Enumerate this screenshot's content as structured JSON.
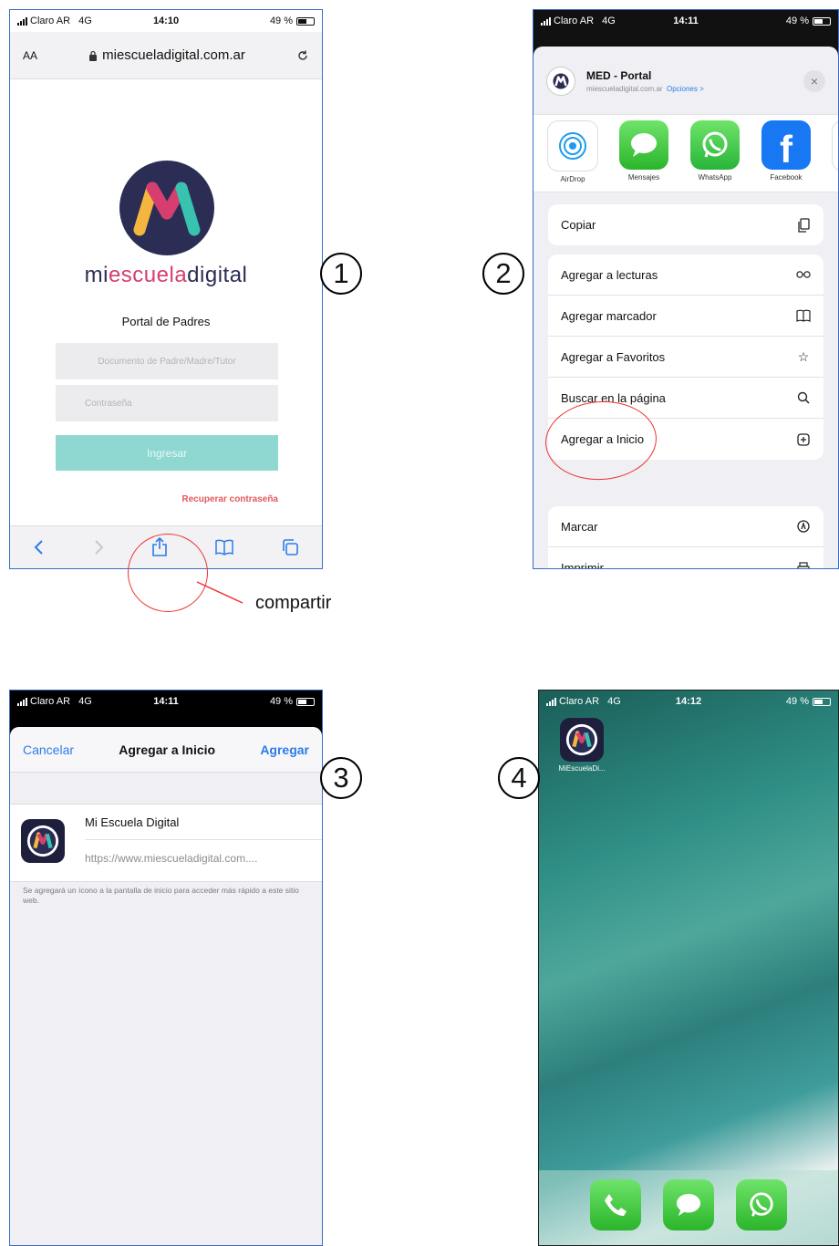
{
  "phone1": {
    "status": {
      "carrier": "Claro AR",
      "network": "4G",
      "time": "14:10",
      "battery": "49 %"
    },
    "url": {
      "text_size": "AA",
      "domain": "miescueladigital.com.ar"
    },
    "brand": {
      "part1": "mi",
      "part2": "escuela",
      "part3": "digital"
    },
    "portal_title": "Portal de Padres",
    "doc_placeholder": "Documento de Padre/Madre/Tutor",
    "pass_placeholder": "Contraseña",
    "login_label": "Ingresar",
    "recover_label": "Recuperar contraseña"
  },
  "annotation": {
    "share_label": "compartir",
    "step1": "1",
    "step2": "2",
    "step3": "3",
    "step4": "4"
  },
  "phone2": {
    "status": {
      "carrier": "Claro AR",
      "network": "4G",
      "time": "14:11",
      "battery": "49 %"
    },
    "title": "MED - Portal",
    "domain": "miescueladigital.com.ar",
    "options": "Opciones >",
    "apps": [
      {
        "label": "AirDrop"
      },
      {
        "label": "Mensajes"
      },
      {
        "label": "WhatsApp"
      },
      {
        "label": "Facebook"
      }
    ],
    "actions": [
      {
        "label": "Copiar",
        "icon": "copy-icon"
      },
      {
        "label": "Agregar a lecturas",
        "icon": "glasses-icon"
      },
      {
        "label": "Agregar marcador",
        "icon": "book-icon"
      },
      {
        "label": "Agregar a Favoritos",
        "icon": "star-icon"
      },
      {
        "label": "Buscar en la página",
        "icon": "search-icon"
      },
      {
        "label": "Agregar a Inicio",
        "icon": "plus-square-icon"
      },
      {
        "label": "Marcar",
        "icon": "markup-icon"
      },
      {
        "label": "Imprimir",
        "icon": "printer-icon"
      }
    ]
  },
  "phone3": {
    "status": {
      "carrier": "Claro AR",
      "network": "4G",
      "time": "14:11",
      "battery": "49 %"
    },
    "cancel": "Cancelar",
    "title": "Agregar a Inicio",
    "add": "Agregar",
    "site_name": "Mi Escuela Digital",
    "site_url": "https://www.miescueladigital.com....",
    "hint": "Se agregará un ícono a la pantalla de inicio para acceder más rápido a este sitio web."
  },
  "phone4": {
    "status": {
      "carrier": "Claro AR",
      "network": "4G",
      "time": "14:12",
      "battery": "49 %"
    },
    "app_label": "MiEscuelaDi..."
  },
  "colors": {
    "brand_navy": "#2b2d55",
    "brand_pink": "#d63e6f",
    "teal_button": "#8fd8d1",
    "ios_blue": "#2b7ce9",
    "annotation_red": "#e33333"
  }
}
